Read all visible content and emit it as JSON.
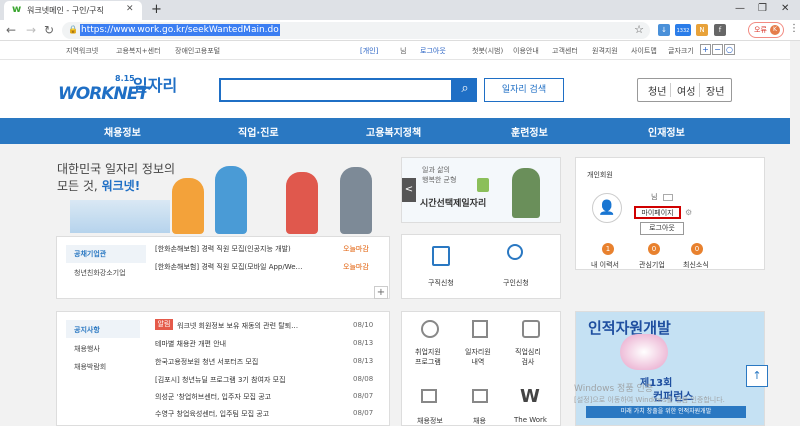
{
  "browser": {
    "tab_title": "워크넷메인 - 구인/구직",
    "url": "https://www.work.go.kr/seekWantedMain.do",
    "ext_badge": "1332",
    "error_label": "오류",
    "avatar_letter": "K"
  },
  "topnav": {
    "left": [
      "지역워크넷",
      "고용복지+센터",
      "장애인고용포털"
    ],
    "user_tag": "[개인]",
    "user_suffix": "님",
    "logout": "로그아웃",
    "right": [
      "첫봇(시범)",
      "이용안내",
      "고객센터",
      "원격지원",
      "사이트맵",
      "글자크기"
    ],
    "font_plus": "+",
    "font_minus": "−",
    "font_reset": "○"
  },
  "header": {
    "logo_date": "8.15",
    "logo_text": "WORKNET",
    "logo_hand": "일자리",
    "search_placeholder": "",
    "job_search_label": "일자리 검색",
    "segments": [
      "청년",
      "여성",
      "장년"
    ]
  },
  "mainmenu": [
    "채용정보",
    "직업·진로",
    "고용복지정책",
    "훈련정보",
    "인재정보"
  ],
  "banner": {
    "line1": "대한민국 일자리 정보의",
    "line2_prefix": "모든 것, ",
    "line2_brand": "워크넷!"
  },
  "news": {
    "tabs": [
      "공채기업관",
      "청년친화강소기업"
    ],
    "items": [
      {
        "text": "[한화손해보험]  경력 직원 모집(인공지능 개발)",
        "badge": "오늘마감"
      },
      {
        "text": "[한화손해보험]  경력 직원 모집(모바일 App/We…",
        "badge": "오늘마감"
      }
    ],
    "more": "+"
  },
  "midbanner": {
    "small1": "일과 삶의",
    "small2": "행복한 균형",
    "title": "시간선택제일자리",
    "prev": "<"
  },
  "quick": [
    {
      "label": "구직신청"
    },
    {
      "label": "구인신청"
    }
  ],
  "login": {
    "title": "개인회원",
    "suffix": "님",
    "mypage": "마이페이지",
    "logout": "로그아웃",
    "stats": [
      {
        "count": "1",
        "label": "내 이력서"
      },
      {
        "count": "0",
        "label": "관심기업"
      },
      {
        "count": "0",
        "label": "최신소식"
      }
    ]
  },
  "notice": {
    "tabs": [
      "공지사항",
      "채용행사",
      "채용박람회"
    ],
    "tag": "알림",
    "items": [
      {
        "text": "워크넷 회원정보 보유 재동의 관련 탈퇴…",
        "date": "08/10"
      },
      {
        "text": "테마별 채용관 개편 안내",
        "date": "08/13"
      },
      {
        "text": "한국고용정보원 청년 서포터즈 모집",
        "date": "08/13"
      },
      {
        "text": "[김포시] 청년뉴딜 프로그램 3기 참여자 모집",
        "date": "08/08"
      },
      {
        "text": "의성군 '창업허브센터, 입주자 모집 공고",
        "date": "08/07"
      },
      {
        "text": "수영구 창업육성센터, 입주팀 모집 공고",
        "date": "08/07"
      }
    ]
  },
  "icons": [
    {
      "label": "취업지원\n프로그램"
    },
    {
      "label": "일자리원\n내역"
    },
    {
      "label": "직업심리\n검사"
    },
    {
      "label": "채용정보"
    },
    {
      "label": "채용"
    },
    {
      "label": "The Work"
    }
  ],
  "ad": {
    "line1": "인적자원개발",
    "ord": "제13회",
    "line2": "컨퍼런스",
    "sub": "미래 가치 창출을 위한 인적자원개발",
    "watermark": "Windows 정품 인증",
    "watermark2": "[설정]으로 이동하여 Windows를 정품 인증합니다."
  },
  "colors": {
    "brand": "#2a78c2",
    "accent": "#e05a00",
    "highlight": "#d00000"
  }
}
